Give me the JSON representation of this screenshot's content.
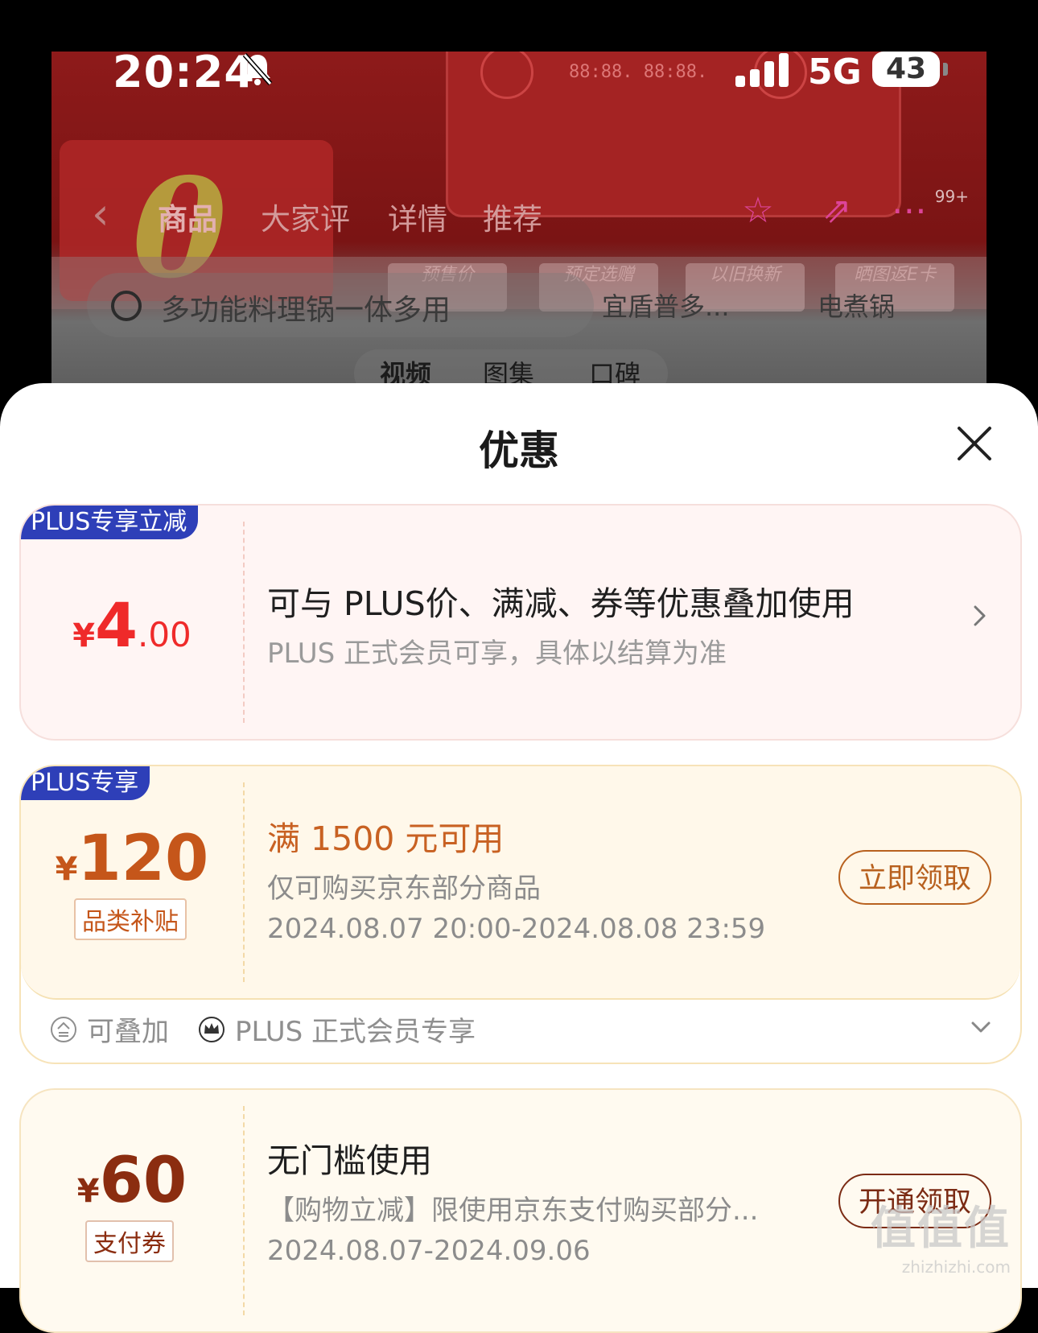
{
  "status_bar": {
    "time": "20:24",
    "network": "5G",
    "battery": "43"
  },
  "background_page": {
    "nav_tabs": [
      "商品",
      "大家评",
      "详情",
      "推荐"
    ],
    "cart_badge": "99+",
    "price_boxes": [
      "预售价",
      "预定选赠",
      "以旧换新",
      "晒图返E卡"
    ],
    "search_placeholder": "多功能料理锅一体多用",
    "chips": [
      "宜盾普多...",
      "电煮锅"
    ],
    "sub_tabs": [
      "视频",
      "图集",
      "口碑"
    ]
  },
  "sheet": {
    "title": "优惠",
    "offers": [
      {
        "tag": "PLUS专享立减",
        "currency": "¥",
        "amount_int": "4",
        "amount_dec": ".00",
        "title": "可与 PLUS价、满减、券等优惠叠加使用",
        "note": "PLUS 正式会员可享，具体以结算为准"
      },
      {
        "tag": "PLUS专享",
        "currency": "¥",
        "amount_int": "120",
        "badge": "品类补贴",
        "title": "满 1500 元可用",
        "scope": "仅可购买京东部分商品",
        "period": "2024.08.07 20:00-2024.08.08 23:59",
        "button": "立即领取",
        "features": [
          "可叠加",
          "PLUS 正式会员专享"
        ]
      },
      {
        "currency": "¥",
        "amount_int": "60",
        "badge": "支付券",
        "title": "无门槛使用",
        "scope": "【购物立减】限使用京东支付购买部分...",
        "period": "2024.08.07-2024.09.06",
        "button": "开通领取"
      }
    ]
  },
  "watermark": {
    "big": "值值值",
    "small": "zhizhizhi.com"
  }
}
